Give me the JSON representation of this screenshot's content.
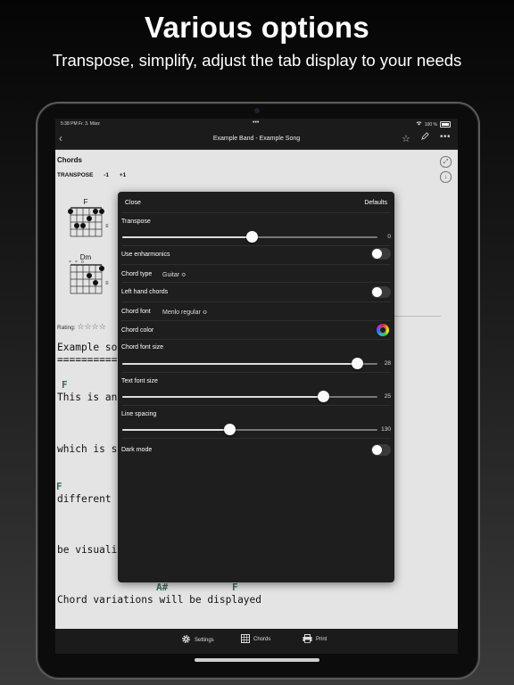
{
  "promo": {
    "headline": "Various options",
    "subline": "Transpose, simplify, adjust the tab display to your needs"
  },
  "statusbar": {
    "time": "5:38 PM  Fr. 3. März",
    "dots": "•••",
    "battery": "100 %"
  },
  "navbar": {
    "back": "‹",
    "title": "Example Band - Example Song",
    "more": "•••"
  },
  "song": {
    "chords_title": "Chords",
    "transpose_label": "TRANSPOSE",
    "transpose_down": "-1",
    "transpose_up": "+1",
    "diagrams": [
      {
        "name": "F"
      },
      {
        "name": "Dm"
      }
    ],
    "rating_label": "Rating:",
    "rating_stars": "☆☆☆☆",
    "lines": [
      "Example so",
      "==========",
      "This is an",
      "which is s",
      "different",
      "be visuali",
      "Chord variations will be displayed"
    ],
    "chord_marks": [
      "F",
      "F",
      "A#",
      "F"
    ]
  },
  "settings": {
    "close": "Close",
    "defaults": "Defaults",
    "transpose": {
      "label": "Transpose",
      "value": "0",
      "position": 0.51
    },
    "use_enharmonics": {
      "label": "Use enharmonics",
      "on": false
    },
    "chord_type": {
      "label": "Chord type",
      "value": "Guitar ≎"
    },
    "left_hand_chords": {
      "label": "Left hand chords",
      "on": false
    },
    "chord_font": {
      "label": "Chord font",
      "value": "Menlo regular ≎"
    },
    "chord_color": {
      "label": "Chord color"
    },
    "chord_font_size": {
      "label": "Chord font size",
      "value": "28",
      "position": 0.92
    },
    "text_font_size": {
      "label": "Text font size",
      "value": "25",
      "position": 0.79
    },
    "line_spacing": {
      "label": "Line spacing",
      "value": "130",
      "position": 0.42
    },
    "dark_mode": {
      "label": "Dark mode",
      "on": false
    }
  },
  "tabbar": {
    "settings": "Settings",
    "chords": "Chords",
    "print": "Print"
  }
}
